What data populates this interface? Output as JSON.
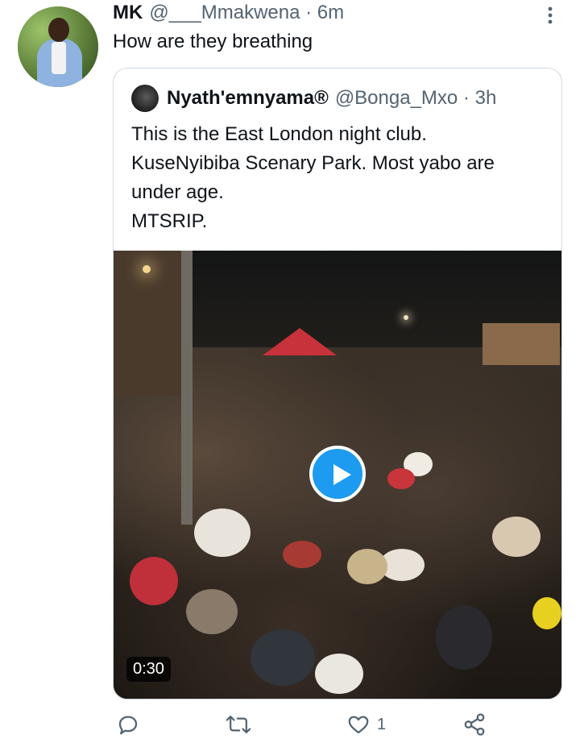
{
  "tweet": {
    "author_name": "MK",
    "author_handle": "@___Mmakwena · 6m",
    "text": "How are they breathing",
    "more_icon": "more-vertical-icon"
  },
  "quoted": {
    "author_name": "Nyath'emnyama®",
    "author_handle": "@Bonga_Mxo · 3h",
    "text_lines": [
      "This is the East London night club.",
      "KuseNyibiba Scenary Park. Most yabo are",
      "under age.",
      "MTSRIP."
    ],
    "media": {
      "type": "video",
      "duration": "0:30",
      "play_icon": "play-icon"
    }
  },
  "actions": {
    "reply_icon": "reply-icon",
    "retweet_icon": "retweet-icon",
    "like_icon": "heart-icon",
    "like_count": "1",
    "share_icon": "share-icon"
  },
  "colors": {
    "accent": "#1d9bf0",
    "text_primary": "#0f1419",
    "text_secondary": "#536471",
    "border": "#cfd9de"
  }
}
